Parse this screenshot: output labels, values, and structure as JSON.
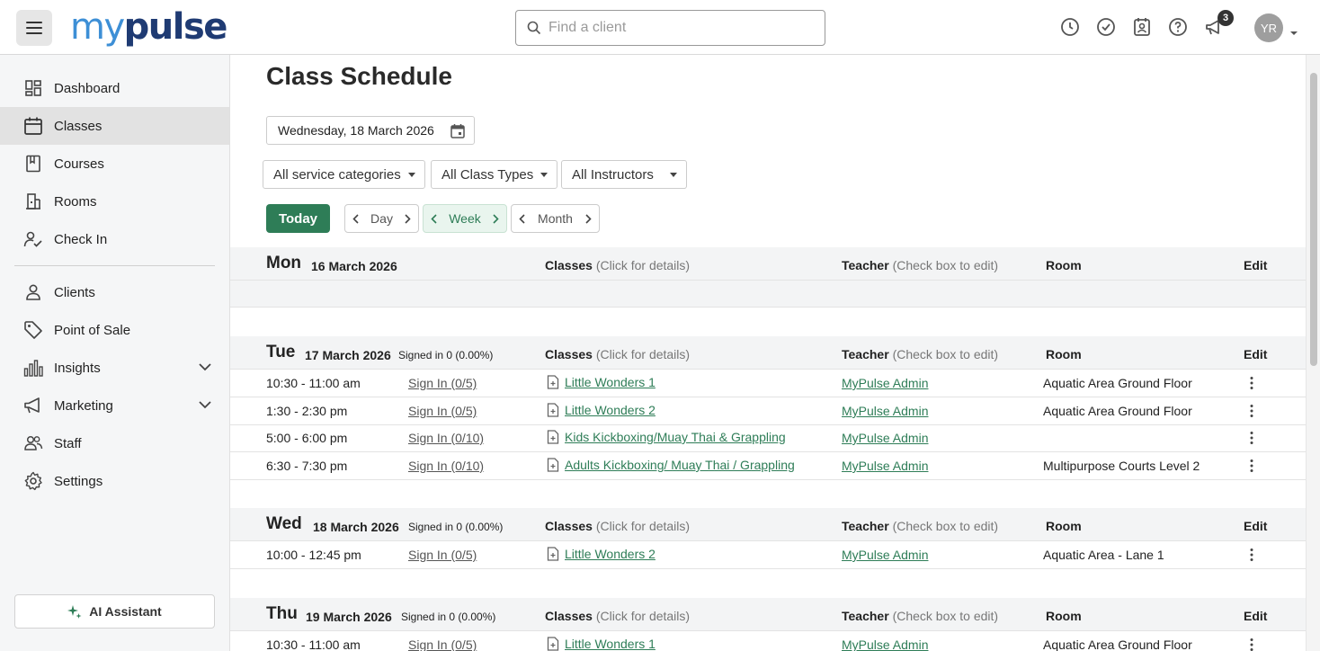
{
  "header": {
    "logo_my": "my",
    "logo_pulse": "pulse",
    "search_placeholder": "Find a client",
    "notification_count": "3",
    "avatar_initials": "YR"
  },
  "sidebar": {
    "items": [
      {
        "label": "Dashboard",
        "icon": "dashboard-icon"
      },
      {
        "label": "Classes",
        "icon": "calendar-icon",
        "active": true
      },
      {
        "label": "Courses",
        "icon": "book-icon"
      },
      {
        "label": "Rooms",
        "icon": "building-icon"
      },
      {
        "label": "Check In",
        "icon": "user-check-icon"
      },
      {
        "label": "Clients",
        "icon": "person-icon"
      },
      {
        "label": "Point of Sale",
        "icon": "tag-icon"
      },
      {
        "label": "Insights",
        "icon": "bar-chart-icon",
        "expandable": true
      },
      {
        "label": "Marketing",
        "icon": "megaphone-icon",
        "expandable": true
      },
      {
        "label": "Staff",
        "icon": "people-icon"
      },
      {
        "label": "Settings",
        "icon": "gear-icon"
      }
    ],
    "ai_assistant_label": "AI Assistant"
  },
  "main": {
    "title": "Class Schedule",
    "date_value": "Wednesday, 18 March 2026",
    "filters": [
      "All service categories",
      "All Class Types",
      "All Instructors"
    ],
    "today_label": "Today",
    "periods": [
      "Day",
      "Week",
      "Month"
    ],
    "active_period": "Week",
    "columns": {
      "classes": "Classes",
      "classes_hint": "(Click for details)",
      "teacher": "Teacher",
      "teacher_hint": "(Check box to edit)",
      "room": "Room",
      "edit": "Edit"
    },
    "days": [
      {
        "day": "Mon",
        "date": "16 March 2026",
        "signed": "",
        "rows": []
      },
      {
        "day": "Tue",
        "date": "17 March 2026",
        "signed": "Signed in 0 (0.00%)",
        "rows": [
          {
            "time": "10:30 - 11:00 am",
            "signin": "Sign In (0/5)",
            "class": "Little Wonders 1",
            "teacher": "MyPulse Admin",
            "room": "Aquatic Area Ground Floor"
          },
          {
            "time": "1:30 - 2:30 pm",
            "signin": "Sign In (0/5)",
            "class": "Little Wonders 2",
            "teacher": "MyPulse Admin",
            "room": "Aquatic Area Ground Floor"
          },
          {
            "time": "5:00 - 6:00 pm",
            "signin": "Sign In (0/10)",
            "class": "Kids Kickboxing/Muay Thai & Grappling",
            "teacher": "MyPulse Admin",
            "room": ""
          },
          {
            "time": "6:30 - 7:30 pm",
            "signin": "Sign In (0/10)",
            "class": "Adults Kickboxing/ Muay Thai / Grappling",
            "teacher": "MyPulse Admin",
            "room": "Multipurpose Courts Level 2"
          }
        ]
      },
      {
        "day": "Wed",
        "date": "18 March 2026",
        "signed": "Signed in 0 (0.00%)",
        "rows": [
          {
            "time": "10:00 - 12:45 pm",
            "signin": "Sign In (0/5)",
            "class": "Little Wonders 2",
            "teacher": "MyPulse Admin",
            "room": "Aquatic Area - Lane 1"
          }
        ]
      },
      {
        "day": "Thu",
        "date": "19 March 2026",
        "signed": "Signed in 0 (0.00%)",
        "rows": [
          {
            "time": "10:30 - 11:00 am",
            "signin": "Sign In (0/5)",
            "class": "Little Wonders 1",
            "teacher": "MyPulse Admin",
            "room": "Aquatic Area Ground Floor"
          }
        ]
      }
    ]
  },
  "colors": {
    "brand_green": "#2e7d57",
    "logo_blue": "#3d8fd6",
    "logo_navy": "#1f3b73"
  }
}
